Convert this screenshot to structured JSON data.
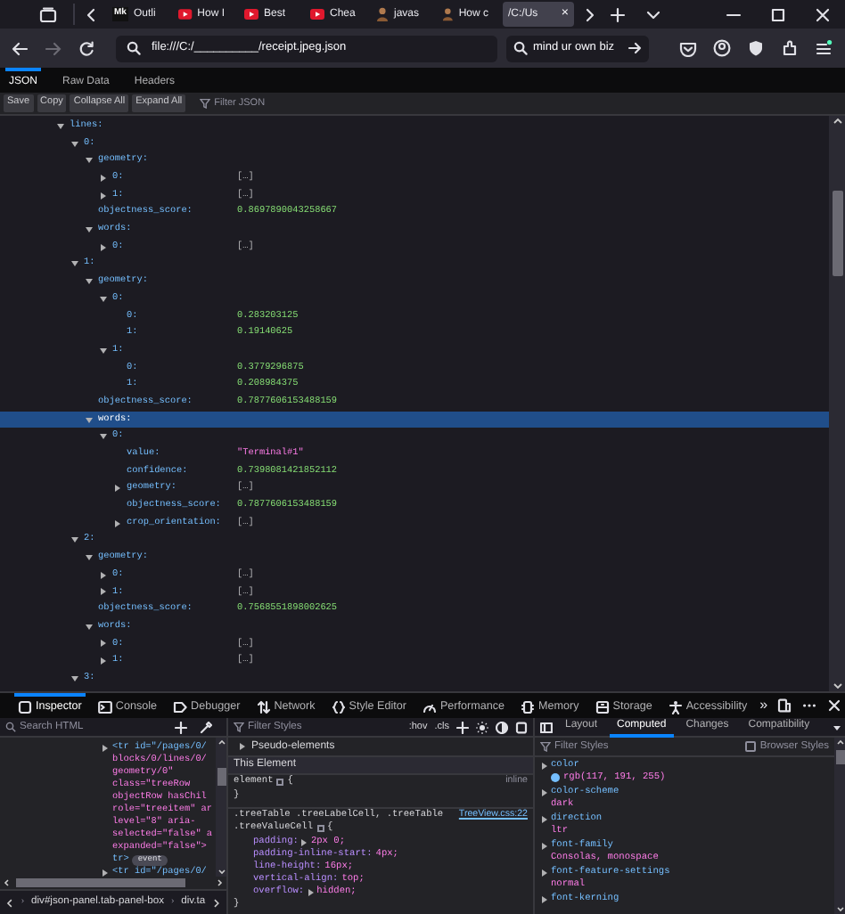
{
  "browser_tabs": [
    {
      "icon": "Mk",
      "kind": "letters",
      "title": "Outli",
      "selected": false
    },
    {
      "kind": "video",
      "title": "How I",
      "selected": false
    },
    {
      "kind": "video",
      "title": "Best",
      "selected": false
    },
    {
      "kind": "video",
      "title": "Chea",
      "selected": false
    },
    {
      "kind": "person",
      "title": "javas",
      "selected": false
    },
    {
      "kind": "person",
      "title": "How c",
      "selected": false
    },
    {
      "kind": "plain",
      "title": "/C:/Us",
      "selected": true,
      "close": "×"
    }
  ],
  "nav": {
    "forward_disabled": true,
    "url": "file:///C:/__________/receipt.jpeg.json",
    "search": "mind ur own biz"
  },
  "viewer_tabs": [
    {
      "label": "JSON",
      "selected": true
    },
    {
      "label": "Raw Data",
      "selected": false
    },
    {
      "label": "Headers",
      "selected": false
    }
  ],
  "toolbar": {
    "buttons": [
      "Save",
      "Copy",
      "Collapse All",
      "Expand All"
    ],
    "filter_placeholder": "Filter JSON"
  },
  "tree": [
    {
      "key": "lines:",
      "expanded": true,
      "selected": false,
      "children": [
        {
          "key": "0:",
          "expanded": true,
          "selected": false,
          "children": [
            {
              "key": "geometry:",
              "expanded": true,
              "selected": false,
              "children": [
                {
                  "key": "0:",
                  "expanded": false,
                  "selected": false,
                  "value": "[…]",
                  "kind": "collapsed"
                },
                {
                  "key": "1:",
                  "expanded": false,
                  "selected": false,
                  "value": "[…]",
                  "kind": "collapsed"
                }
              ]
            },
            {
              "key": "objectness_score:",
              "selected": false,
              "value": "0.8697890043258667",
              "kind": "number"
            },
            {
              "key": "words:",
              "expanded": true,
              "selected": false,
              "children": [
                {
                  "key": "0:",
                  "expanded": false,
                  "selected": false,
                  "value": "[…]",
                  "kind": "collapsed"
                }
              ]
            }
          ]
        },
        {
          "key": "1:",
          "expanded": true,
          "selected": false,
          "children": [
            {
              "key": "geometry:",
              "expanded": true,
              "selected": false,
              "children": [
                {
                  "key": "0:",
                  "expanded": true,
                  "selected": false,
                  "children": [
                    {
                      "key": "0:",
                      "selected": false,
                      "value": "0.283203125",
                      "kind": "number"
                    },
                    {
                      "key": "1:",
                      "selected": false,
                      "value": "0.19140625",
                      "kind": "number"
                    }
                  ]
                },
                {
                  "key": "1:",
                  "expanded": true,
                  "selected": false,
                  "children": [
                    {
                      "key": "0:",
                      "selected": false,
                      "value": "0.3779296875",
                      "kind": "number"
                    },
                    {
                      "key": "1:",
                      "selected": false,
                      "value": "0.208984375",
                      "kind": "number"
                    }
                  ]
                }
              ]
            },
            {
              "key": "objectness_score:",
              "selected": false,
              "value": "0.7877606153488159",
              "kind": "number"
            },
            {
              "key": "words:",
              "expanded": true,
              "selected": true,
              "children": [
                {
                  "key": "0:",
                  "expanded": true,
                  "selected": false,
                  "children": [
                    {
                      "key": "value:",
                      "selected": false,
                      "value": "\"Terminal#1\"",
                      "kind": "string"
                    },
                    {
                      "key": "confidence:",
                      "selected": false,
                      "value": "0.7398081421852112",
                      "kind": "number"
                    },
                    {
                      "key": "geometry:",
                      "expanded": false,
                      "selected": false,
                      "value": "[…]",
                      "kind": "collapsed"
                    },
                    {
                      "key": "objectness_score:",
                      "selected": false,
                      "value": "0.7877606153488159",
                      "kind": "number"
                    },
                    {
                      "key": "crop_orientation:",
                      "expanded": false,
                      "selected": false,
                      "value": "[…]",
                      "kind": "collapsed"
                    }
                  ]
                }
              ]
            }
          ]
        },
        {
          "key": "2:",
          "expanded": true,
          "selected": false,
          "children": [
            {
              "key": "geometry:",
              "expanded": true,
              "selected": false,
              "children": [
                {
                  "key": "0:",
                  "expanded": false,
                  "selected": false,
                  "value": "[…]",
                  "kind": "collapsed"
                },
                {
                  "key": "1:",
                  "expanded": false,
                  "selected": false,
                  "value": "[…]",
                  "kind": "collapsed"
                }
              ]
            },
            {
              "key": "objectness_score:",
              "selected": false,
              "value": "0.7568551898002625",
              "kind": "number"
            },
            {
              "key": "words:",
              "expanded": true,
              "selected": false,
              "children": [
                {
                  "key": "0:",
                  "expanded": false,
                  "selected": false,
                  "value": "[…]",
                  "kind": "collapsed"
                },
                {
                  "key": "1:",
                  "expanded": false,
                  "selected": false,
                  "value": "[…]",
                  "kind": "collapsed"
                }
              ]
            }
          ]
        },
        {
          "key": "3:",
          "expanded": true,
          "selected": false
        }
      ]
    }
  ],
  "devtools": {
    "tabs": [
      {
        "label": "Inspector",
        "selected": true
      },
      {
        "label": "Console",
        "selected": false
      },
      {
        "label": "Debugger",
        "selected": false
      },
      {
        "label": "Network",
        "selected": false
      },
      {
        "label": "Style Editor",
        "selected": false
      },
      {
        "label": "Performance",
        "selected": false
      },
      {
        "label": "Memory",
        "selected": false
      },
      {
        "label": "Storage",
        "selected": false
      },
      {
        "label": "Accessibility",
        "selected": false
      }
    ],
    "more": "»",
    "search_placeholder": "Search HTML",
    "html_lines": [
      {
        "kind": "element",
        "text": "<tr id=\"/pages/0/"
      },
      {
        "kind": "continuation",
        "text": "blocks/0/lines/0/"
      },
      {
        "kind": "continuation",
        "text": "geometry/0\""
      },
      {
        "kind": "continuation",
        "text": "class=\"treeRow"
      },
      {
        "kind": "continuation",
        "text": "objectRow hasChil"
      },
      {
        "kind": "continuation",
        "text": "role=\"treeitem\" ar"
      },
      {
        "kind": "continuation",
        "text": "level=\"8\" aria-"
      },
      {
        "kind": "continuation",
        "text": "selected=\"false\" a"
      },
      {
        "kind": "continuation",
        "text": "expanded=\"false\">"
      },
      {
        "kind": "closing",
        "text": "tr>",
        "badge": "event"
      },
      {
        "kind": "element",
        "text": "<tr id=\"/pages/0/"
      }
    ],
    "breadcrumb_separator": "›",
    "breadcrumbs": [
      "div#json-panel.tab-panel-box",
      "div.ta"
    ],
    "rules": {
      "filter_placeholder": "Filter Styles",
      "hov": ":hov",
      "cls": ".cls",
      "pseudo": "Pseudo-elements",
      "section": "This Element",
      "element_rule": {
        "selector": "element",
        "open": "{",
        "origin": "inline",
        "close": "}"
      },
      "rule": {
        "selector_1": ".treeTable .treeLabelCell, .treeTable",
        "selector_2": ".treeValueCell",
        "open": "{",
        "source": "TreeView.css:22",
        "close": "}",
        "declarations": [
          {
            "name": "padding:",
            "value": "2px 0;",
            "expandable": true
          },
          {
            "name": "padding-inline-start:",
            "value": "4px;",
            "expandable": false
          },
          {
            "name": "line-height:",
            "value": "16px;",
            "expandable": false
          },
          {
            "name": "vertical-align:",
            "value": "top;",
            "expandable": false
          },
          {
            "name": "overflow:",
            "value": "hidden;",
            "expandable": true
          }
        ]
      }
    },
    "side_tabs": [
      {
        "label": "Layout",
        "selected": false
      },
      {
        "label": "Computed",
        "selected": true
      },
      {
        "label": "Changes",
        "selected": false
      },
      {
        "label": "Compatibility",
        "selected": false
      }
    ],
    "computed": {
      "filter_placeholder": "Filter Styles",
      "browser_styles": {
        "label": "Browser Styles",
        "checked": false
      },
      "properties": [
        {
          "name": "color",
          "value": "rgb(117, 191, 255)",
          "color": "#75bfff"
        },
        {
          "name": "color-scheme",
          "value": "dark"
        },
        {
          "name": "direction",
          "value": "ltr"
        },
        {
          "name": "font-family",
          "value": "Consolas, monospace"
        },
        {
          "name": "font-feature-settings",
          "value": "normal"
        },
        {
          "name": "font-kerning"
        }
      ]
    }
  }
}
